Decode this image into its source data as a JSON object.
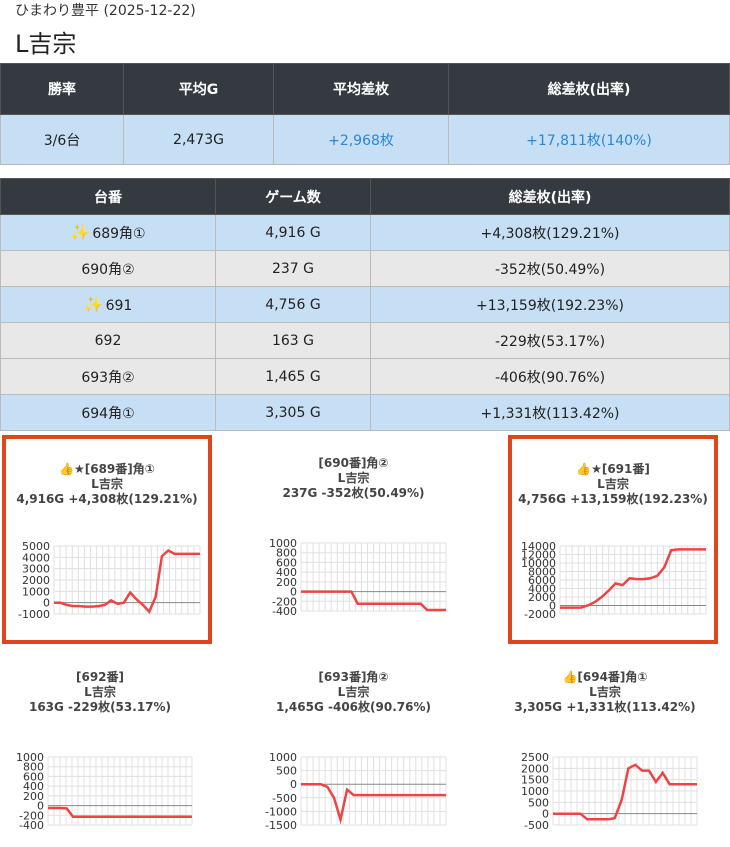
{
  "header": {
    "store_date": "ひまわり豊平 (2025-12-22)",
    "title": "L吉宗"
  },
  "summary": {
    "headers": [
      "勝率",
      "平均G",
      "平均差枚",
      "総差枚(出率)"
    ],
    "values": [
      "3/6台",
      "2,473G",
      "+2,968枚",
      "+17,811枚(140%)"
    ]
  },
  "machines": {
    "headers": [
      "台番",
      "ゲーム数",
      "総差枚(出率)"
    ],
    "rows": [
      {
        "icon": "✨",
        "name": "689角①",
        "games": "4,916 G",
        "diff": "+4,308枚(129.21%)",
        "style": "blue"
      },
      {
        "icon": "",
        "name": "690角②",
        "games": "237 G",
        "diff": "-352枚(50.49%)",
        "style": "gray"
      },
      {
        "icon": "✨",
        "name": "691",
        "games": "4,756 G",
        "diff": "+13,159枚(192.23%)",
        "style": "blue"
      },
      {
        "icon": "",
        "name": "692",
        "games": "163 G",
        "diff": "-229枚(53.17%)",
        "style": "gray"
      },
      {
        "icon": "",
        "name": "693角②",
        "games": "1,465 G",
        "diff": "-406枚(90.76%)",
        "style": "gray"
      },
      {
        "icon": "",
        "name": "694角①",
        "games": "3,305 G",
        "diff": "+1,331枚(113.42%)",
        "style": "blue"
      }
    ]
  },
  "cards": [
    {
      "line1": "👍★[689番]角①",
      "line2": "L吉宗",
      "line3": "4,916G +4,308枚(129.21%)",
      "highlight": true,
      "chart": {
        "ymin": -1000,
        "ymax": 5000,
        "ticks": [
          5000,
          4000,
          3000,
          2000,
          1000,
          0,
          -1000
        ],
        "points": [
          0,
          0,
          -200,
          -300,
          -300,
          -350,
          -350,
          -300,
          -200,
          200,
          -100,
          0,
          900,
          300,
          -200,
          -800,
          500,
          4100,
          4600,
          4300,
          4300,
          4300,
          4300,
          4300
        ]
      }
    },
    {
      "line1": "[690番]角②",
      "line2": "L吉宗",
      "line3": "237G -352枚(50.49%)",
      "highlight": false,
      "chart": {
        "ymin": -400,
        "ymax": 1000,
        "ticks": [
          1000,
          800,
          600,
          400,
          200,
          0,
          -200,
          -400
        ],
        "points": [
          0,
          0,
          0,
          0,
          0,
          0,
          0,
          0,
          0,
          -250,
          -250,
          -250,
          -250,
          -250,
          -250,
          -250,
          -250,
          -250,
          -250,
          -250,
          -380,
          -380,
          -380,
          -380
        ]
      }
    },
    {
      "line1": "👍★[691番]",
      "line2": "L吉宗",
      "line3": "4,756G +13,159枚(192.23%)",
      "highlight": true,
      "chart": {
        "ymin": -2000,
        "ymax": 14000,
        "ticks": [
          14000,
          12000,
          10000,
          8000,
          6000,
          4000,
          2000,
          0,
          -2000
        ],
        "points": [
          -500,
          -500,
          -500,
          -500,
          0,
          800,
          2000,
          3500,
          5200,
          4800,
          6400,
          6200,
          6200,
          6400,
          7000,
          9000,
          13000,
          13200,
          13200,
          13200,
          13200,
          13200
        ]
      }
    },
    {
      "line1": "[692番]",
      "line2": "L吉宗",
      "line3": "163G -229枚(53.17%)",
      "highlight": false,
      "chart": {
        "ymin": -400,
        "ymax": 1000,
        "ticks": [
          1000,
          800,
          600,
          400,
          200,
          0,
          -200,
          -400
        ],
        "points": [
          -50,
          -50,
          -50,
          -60,
          -230,
          -230,
          -230,
          -230,
          -230,
          -230,
          -230,
          -230,
          -230,
          -230,
          -230,
          -230,
          -230,
          -230,
          -230,
          -230,
          -230,
          -230,
          -230,
          -230
        ]
      }
    },
    {
      "line1": "[693番]角②",
      "line2": "L吉宗",
      "line3": "1,465G -406枚(90.76%)",
      "highlight": false,
      "chart": {
        "ymin": -1500,
        "ymax": 1000,
        "ticks": [
          1000,
          500,
          0,
          -500,
          -1000,
          -1500
        ],
        "points": [
          0,
          0,
          0,
          0,
          -100,
          -500,
          -1300,
          -200,
          -400,
          -400,
          -400,
          -400,
          -400,
          -400,
          -400,
          -400,
          -400,
          -400,
          -400,
          -400,
          -400,
          -400,
          -400
        ]
      }
    },
    {
      "line1": "👍[694番]角①",
      "line2": "L吉宗",
      "line3": "3,305G +1,331枚(113.42%)",
      "highlight": false,
      "chart": {
        "ymin": -500,
        "ymax": 2500,
        "ticks": [
          2500,
          2000,
          1500,
          1000,
          500,
          0,
          -500
        ],
        "points": [
          0,
          0,
          0,
          0,
          0,
          -250,
          -250,
          -250,
          -250,
          -200,
          600,
          2000,
          2150,
          1900,
          1900,
          1400,
          1800,
          1300,
          1300,
          1300,
          1300,
          1300
        ]
      }
    }
  ]
}
